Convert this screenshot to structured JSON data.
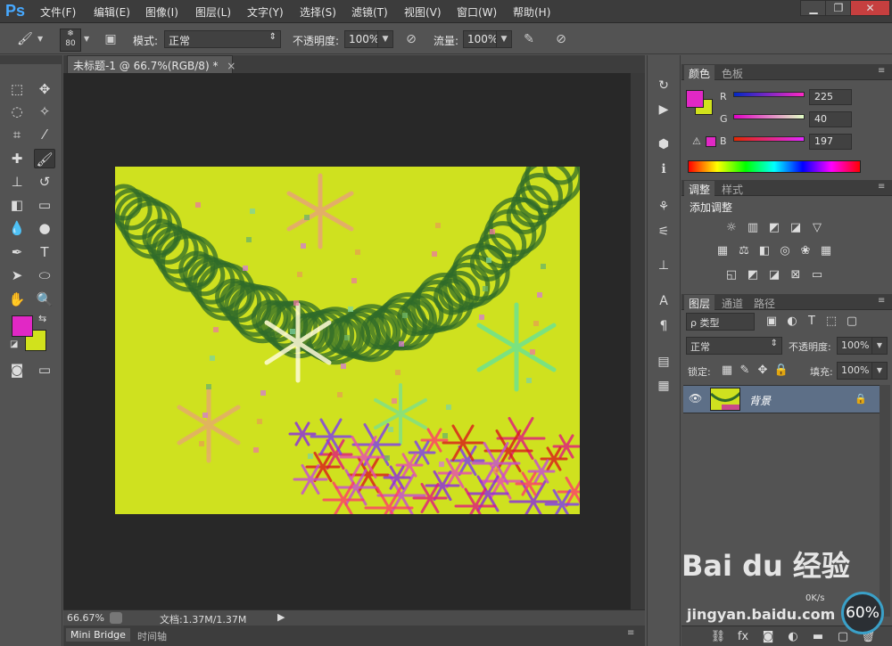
{
  "app": {
    "logo": "Ps"
  },
  "menu": [
    "文件(F)",
    "编辑(E)",
    "图像(I)",
    "图层(L)",
    "文字(Y)",
    "选择(S)",
    "滤镜(T)",
    "视图(V)",
    "窗口(W)",
    "帮助(H)"
  ],
  "window_controls": {
    "minimize": "▁",
    "restore": "❐",
    "close": "✕"
  },
  "options": {
    "brush_size": "80",
    "mode_label": "模式:",
    "mode_value": "正常",
    "opacity_label": "不透明度:",
    "opacity_value": "100%",
    "flow_label": "流量:",
    "flow_value": "100%"
  },
  "document": {
    "tab_title": "未标题-1 @ 66.7%(RGB/8) *",
    "tab_close": "×",
    "zoom": "66.67%",
    "doc_info": "文档:1.37M/1.37M"
  },
  "bottom_tabs": [
    "Mini Bridge",
    "时间轴"
  ],
  "color_panel": {
    "tabs": [
      "颜色",
      "色板"
    ],
    "foreground": "#e128c5",
    "background": "#d1e21c",
    "r_label": "R",
    "r_value": "225",
    "g_label": "G",
    "g_value": "40",
    "b_label": "B",
    "b_value": "197"
  },
  "adjust_panel": {
    "tabs": [
      "调整",
      "样式"
    ],
    "title": "添加调整"
  },
  "layers_panel": {
    "tabs": [
      "图层",
      "通道",
      "路径"
    ],
    "filter_label": "ρ 类型",
    "blend_mode": "正常",
    "opacity_label": "不透明度:",
    "opacity_value": "100%",
    "lock_label": "锁定:",
    "fill_label": "填充:",
    "fill_value": "100%",
    "layer_name": "背景"
  },
  "icons": {
    "brush": "brush-icon",
    "eye": "eye-icon",
    "lock": "lock-icon"
  },
  "overlay": {
    "watermark_text": "Bai du 经验",
    "watermark_url": "jingyan.baidu.com",
    "net_speed": "0K/s",
    "net_percent": "60%"
  }
}
